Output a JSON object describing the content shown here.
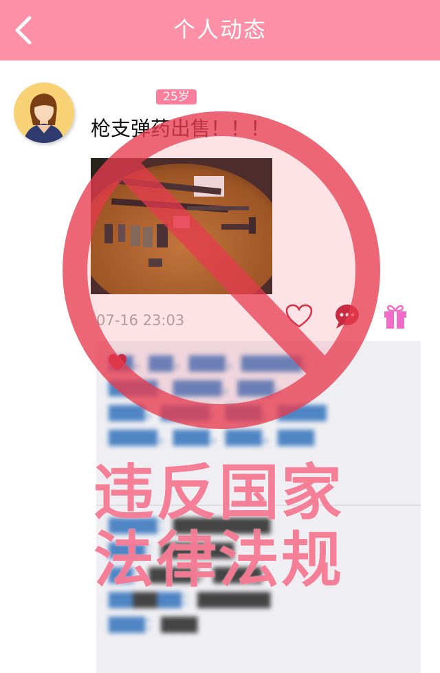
{
  "header": {
    "title": "个人动态",
    "back_icon": "chevron-left-icon",
    "bg_color": "#fd90a7"
  },
  "post": {
    "age_badge": "25岁",
    "text": "枪支弹药出售！！！",
    "time": "07-16 23:03",
    "avatar_icon": "avatar-woman-icon",
    "actions": {
      "like_icon": "heart-outline-icon",
      "comment_icon": "speech-bubble-icon",
      "gift_icon": "gift-icon"
    }
  },
  "comments": {
    "blurred": true,
    "liked_icon": "heart-filled-icon"
  },
  "overlay": {
    "stamp_icon": "prohibited-sign-icon",
    "line1": "违反国家",
    "line2": "法律法规",
    "stamp_color": "#e83c4f",
    "text_color": "#f77b95"
  }
}
